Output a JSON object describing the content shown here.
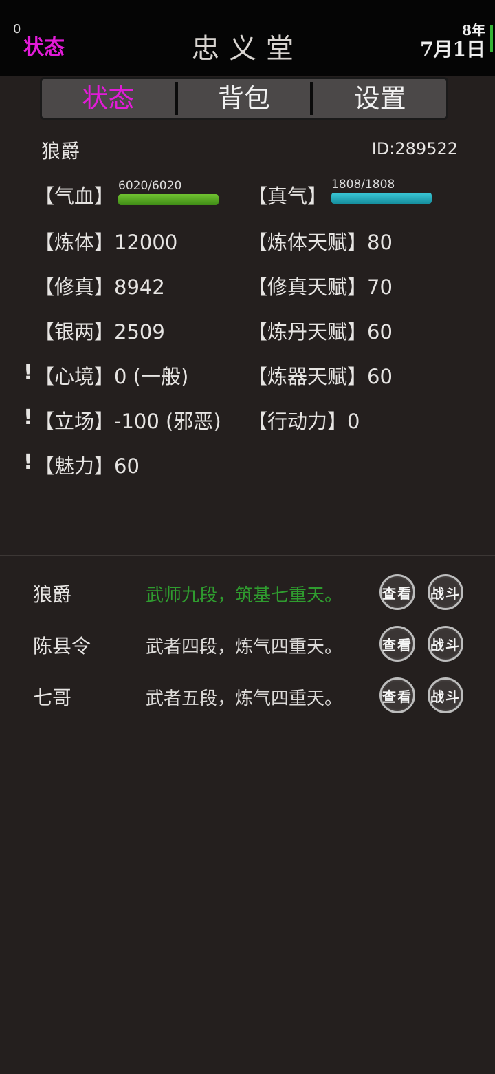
{
  "topbar": {
    "counter": "0",
    "status": "状态",
    "title": "忠义堂",
    "year": "8年",
    "date": "7月1日"
  },
  "tabs": [
    {
      "label": "状态",
      "active": true
    },
    {
      "label": "背包",
      "active": false
    },
    {
      "label": "设置",
      "active": false
    }
  ],
  "player": {
    "name": "狼爵",
    "id": "ID:289522",
    "hp_label": "【气血】",
    "hp_text": "6020/6020",
    "hp_fraction": 1.0,
    "mp_label": "【真气】",
    "mp_text": "1808/1808",
    "mp_fraction": 1.0
  },
  "stats": {
    "lianti": {
      "label": "【炼体】",
      "value": "12000"
    },
    "liantitianfu": {
      "label": "【炼体天赋】",
      "value": "80"
    },
    "xiuzhen": {
      "label": "【修真】",
      "value": "8942"
    },
    "xiuzhentianfu": {
      "label": "【修真天赋】",
      "value": "70"
    },
    "yinliang": {
      "label": "【银两】",
      "value": "2509"
    },
    "liandantianfu": {
      "label": "【炼丹天赋】",
      "value": "60"
    },
    "xinjing": {
      "label": "【心境】",
      "value": "0 (一般)"
    },
    "lianqitianfu": {
      "label": "【炼器天赋】",
      "value": "60"
    },
    "lichang": {
      "label": "【立场】",
      "value": "-100 (邪恶)"
    },
    "xingdongli": {
      "label": "【行动力】",
      "value": "0"
    },
    "meili": {
      "label": "【魅力】",
      "value": "60"
    },
    "warn_mark": "!"
  },
  "members": [
    {
      "name": "狼爵",
      "desc": "武师九段，筑基七重天。",
      "view": "查看",
      "fight": "战斗"
    },
    {
      "name": "陈县令",
      "desc": "武者四段，炼气四重天。",
      "view": "查看",
      "fight": "战斗"
    },
    {
      "name": "七哥",
      "desc": "武者五段，炼气四重天。",
      "view": "查看",
      "fight": "战斗"
    }
  ],
  "colors": {
    "accent": "#e21bd8",
    "hp_bar": "#4fa61f",
    "mp_bar": "#1fb0c0",
    "highlight_text": "#2f9c2f"
  }
}
